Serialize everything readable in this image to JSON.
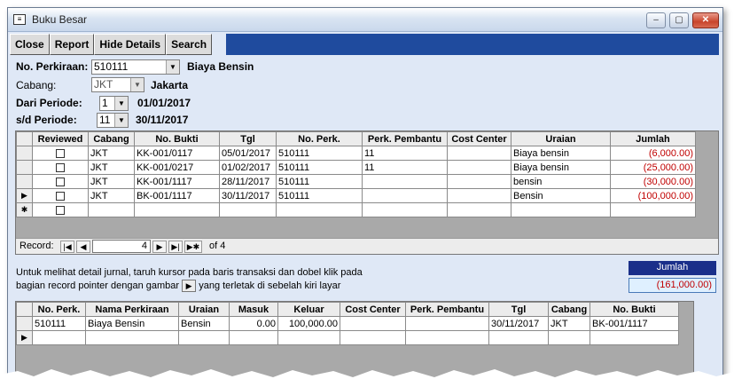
{
  "window": {
    "title": "Buku Besar",
    "minimize": "–",
    "maximize": "▢",
    "close": "✕"
  },
  "toolbar": {
    "close": "Close",
    "report": "Report",
    "hide": "Hide Details",
    "search": "Search"
  },
  "form": {
    "no_perkiraan_label": "No. Perkiraan:",
    "no_perkiraan_value": "510111",
    "no_perkiraan_name": "Biaya Bensin",
    "cabang_label": "Cabang:",
    "cabang_value": "JKT",
    "cabang_name": "Jakarta",
    "dari_label": "Dari Periode:",
    "dari_value": "1",
    "dari_date": "01/01/2017",
    "sd_label": "s/d Periode:",
    "sd_value": "11",
    "sd_date": "30/11/2017"
  },
  "grid1": {
    "headers": [
      "Reviewed",
      "Cabang",
      "No. Bukti",
      "Tgl",
      "No. Perk.",
      "Perk. Pembantu",
      "Cost Center",
      "Uraian",
      "Jumlah"
    ],
    "rows": [
      {
        "cabang": "JKT",
        "bukti": "KK-001/0117",
        "tgl": "05/01/2017",
        "perk": "510111",
        "pembantu": "11",
        "cost": "",
        "uraian": "Biaya bensin",
        "jumlah": "(6,000.00)"
      },
      {
        "cabang": "JKT",
        "bukti": "KK-001/0217",
        "tgl": "01/02/2017",
        "perk": "510111",
        "pembantu": "11",
        "cost": "",
        "uraian": "Biaya bensin",
        "jumlah": "(25,000.00)"
      },
      {
        "cabang": "JKT",
        "bukti": "KK-001/1117",
        "tgl": "28/11/2017",
        "perk": "510111",
        "pembantu": "",
        "cost": "",
        "uraian": "bensin",
        "jumlah": "(30,000.00)"
      },
      {
        "cabang": "JKT",
        "bukti": "BK-001/1117",
        "tgl": "30/11/2017",
        "perk": "510111",
        "pembantu": "",
        "cost": "",
        "uraian": "Bensin",
        "jumlah": "(100,000.00)"
      }
    ],
    "record_label": "Record:",
    "record_value": "4",
    "record_of": "of  4"
  },
  "info": {
    "line1": "Untuk melihat detail jurnal, taruh kursor pada baris transaksi dan dobel klik pada",
    "line2a": "bagian record pointer dengan gambar",
    "line2b": "yang terletak di sebelah kiri layar"
  },
  "jumlah": {
    "label": "Jumlah",
    "value": "(161,000.00)"
  },
  "grid2": {
    "headers": [
      "No. Perk.",
      "Nama Perkiraan",
      "Uraian",
      "Masuk",
      "Keluar",
      "Cost Center",
      "Perk. Pembantu",
      "Tgl",
      "Cabang",
      "No. Bukti"
    ],
    "row": {
      "perk": "510111",
      "nama": "Biaya Bensin",
      "uraian": "Bensin",
      "masuk": "0.00",
      "keluar": "100,000.00",
      "cost": "",
      "pembantu": "",
      "tgl": "30/11/2017",
      "cabang": "JKT",
      "bukti": "BK-001/1117"
    }
  }
}
